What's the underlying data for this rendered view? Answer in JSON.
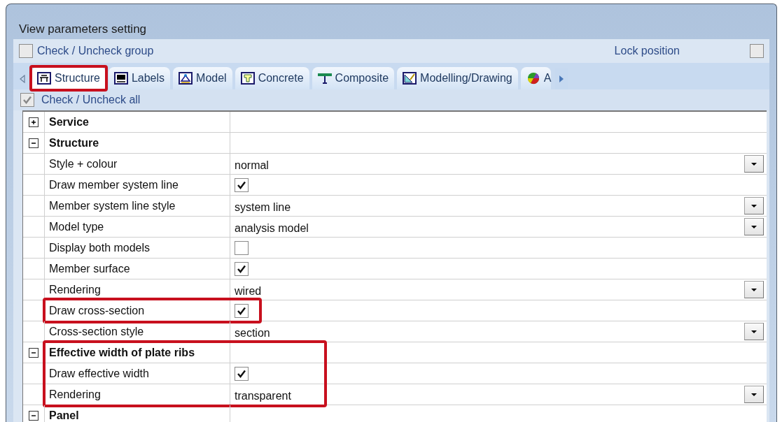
{
  "window": {
    "title": "View parameters setting"
  },
  "group_toggle": {
    "label": "Check / Uncheck group",
    "checked": false
  },
  "lock_position": {
    "label": "Lock position",
    "checked": false
  },
  "tabs": [
    {
      "label": "Structure",
      "selected": true,
      "highlighted": true
    },
    {
      "label": "Labels",
      "selected": false,
      "highlighted": false
    },
    {
      "label": "Model",
      "selected": false,
      "highlighted": false
    },
    {
      "label": "Concrete",
      "selected": false,
      "highlighted": false
    },
    {
      "label": "Composite",
      "selected": false,
      "highlighted": false
    },
    {
      "label": "Modelling/Drawing",
      "selected": false,
      "highlighted": false
    },
    {
      "label": "A",
      "selected": false,
      "highlighted": false
    }
  ],
  "check_all": {
    "label": "Check / Uncheck all",
    "checked": true
  },
  "groups": [
    {
      "label": "Service",
      "expanded": false,
      "highlighted": false
    },
    {
      "label": "Structure",
      "expanded": true,
      "highlighted": false,
      "children": [
        {
          "label": "Style + colour",
          "kind": "dropdown",
          "value": "normal",
          "highlighted": false
        },
        {
          "label": "Draw member system line",
          "kind": "checkbox",
          "checked": true,
          "highlighted": false
        },
        {
          "label": "Member system line style",
          "kind": "dropdown",
          "value": "system line",
          "highlighted": false
        },
        {
          "label": "Model type",
          "kind": "dropdown",
          "value": "analysis model",
          "highlighted": false
        },
        {
          "label": "Display both models",
          "kind": "checkbox",
          "checked": false,
          "highlighted": false
        },
        {
          "label": "Member surface",
          "kind": "checkbox",
          "checked": true,
          "highlighted": false
        },
        {
          "label": "Rendering",
          "kind": "dropdown",
          "value": "wired",
          "highlighted": false
        },
        {
          "label": "Draw cross-section",
          "kind": "checkbox",
          "checked": true,
          "highlighted": true
        },
        {
          "label": "Cross-section style",
          "kind": "dropdown",
          "value": "section",
          "highlighted": false
        }
      ]
    },
    {
      "label": "Effective width of plate ribs",
      "expanded": true,
      "highlighted": true,
      "children": [
        {
          "label": "Draw effective width",
          "kind": "checkbox",
          "checked": true,
          "highlighted": false
        },
        {
          "label": "Rendering",
          "kind": "dropdown",
          "value": "transparent",
          "highlighted": false
        }
      ]
    },
    {
      "label": "Panel",
      "expanded": true,
      "highlighted": false
    }
  ]
}
